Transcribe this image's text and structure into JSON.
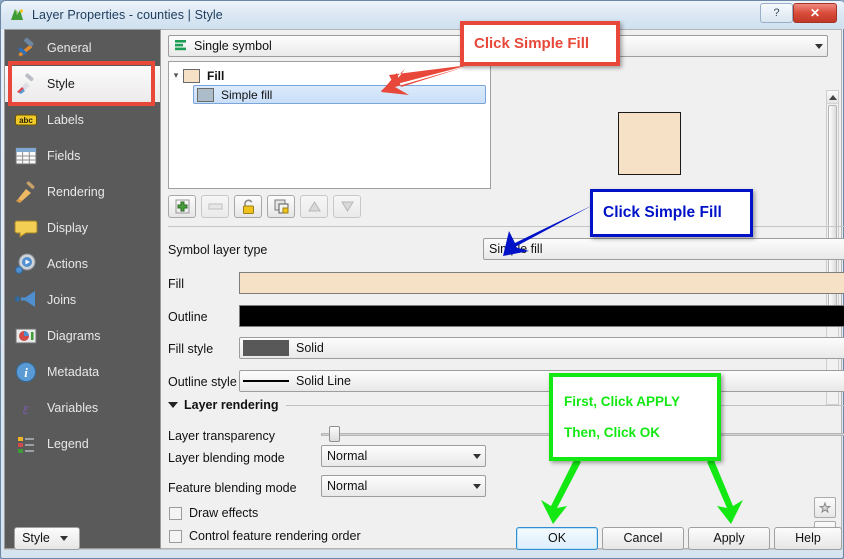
{
  "window": {
    "title": "Layer Properties - counties | Style",
    "app_icon": "qgis-icon",
    "help_button": "?",
    "close_button": "✕"
  },
  "sidebar": {
    "items": [
      {
        "label": "General",
        "icon": "hammer-wrench-icon",
        "selected": false
      },
      {
        "label": "Style",
        "icon": "paintbrush-icon",
        "selected": true
      },
      {
        "label": "Labels",
        "icon": "abc-label-icon",
        "selected": false
      },
      {
        "label": "Fields",
        "icon": "table-grid-icon",
        "selected": false
      },
      {
        "label": "Rendering",
        "icon": "broom-icon",
        "selected": false
      },
      {
        "label": "Display",
        "icon": "speech-bubble-icon",
        "selected": false
      },
      {
        "label": "Actions",
        "icon": "gear-play-icon",
        "selected": false
      },
      {
        "label": "Joins",
        "icon": "join-arrow-icon",
        "selected": false
      },
      {
        "label": "Diagrams",
        "icon": "pie-chart-icon",
        "selected": false
      },
      {
        "label": "Metadata",
        "icon": "info-circle-icon",
        "selected": false
      },
      {
        "label": "Variables",
        "icon": "epsilon-icon",
        "selected": false
      },
      {
        "label": "Legend",
        "icon": "legend-list-icon",
        "selected": false
      }
    ]
  },
  "renderer": {
    "selected": "Single symbol",
    "icon": "single-symbol-icon"
  },
  "symbol_tree": {
    "parent": {
      "label": "Fill",
      "swatch_color": "#f6e0c6",
      "expanded": true
    },
    "child": {
      "label": "Simple fill",
      "swatch_color": "#adbcc9",
      "selected": true
    }
  },
  "symbol_preview": {
    "fill_color": "#f6e0c6",
    "outline_color": "#1a1a1a"
  },
  "layer_toolbar": {
    "buttons": [
      {
        "name": "add-symbol-layer",
        "icon": "plus-icon",
        "enabled": true
      },
      {
        "name": "remove-symbol-layer",
        "icon": "minus-icon",
        "enabled": false
      },
      {
        "name": "lock-colors",
        "icon": "lock-icon",
        "enabled": true
      },
      {
        "name": "duplicate-layer",
        "icon": "duplicate-icon",
        "enabled": true
      },
      {
        "name": "move-layer-up",
        "icon": "arrow-up-icon",
        "enabled": false
      },
      {
        "name": "move-layer-down",
        "icon": "arrow-down-icon",
        "enabled": false
      }
    ]
  },
  "symbol_form": {
    "symbol_layer_type": {
      "label": "Symbol layer type",
      "value": "Simple fill"
    },
    "fill": {
      "label": "Fill",
      "color": "#f6e0c6"
    },
    "outline": {
      "label": "Outline",
      "color": "#000000"
    },
    "fill_style": {
      "label": "Fill style",
      "value": "Solid",
      "chip_color": "#585858"
    },
    "outline_style": {
      "label": "Outline style",
      "value": "Solid Line",
      "chip_color": "#000000"
    },
    "data_defined_icon": "data-defined-override-icon"
  },
  "layer_rendering": {
    "title": "Layer rendering",
    "transparency": {
      "label": "Layer transparency",
      "value": "0"
    },
    "layer_blending": {
      "label": "Layer blending mode",
      "value": "Normal"
    },
    "feature_blending": {
      "label": "Feature blending mode",
      "value": "Normal"
    },
    "draw_effects": {
      "label": "Draw effects",
      "checked": false
    },
    "control_order": {
      "label": "Control feature rendering order",
      "checked": false
    },
    "effects_button": "effects-star-icon",
    "sort_button": "sort-az-icon"
  },
  "footer": {
    "style_button": "Style",
    "ok_button": "OK",
    "cancel_button": "Cancel",
    "apply_button": "Apply",
    "help_button": "Help"
  },
  "annotations": {
    "red_callout": {
      "text": "Click Simple Fill",
      "color": "#e8483a"
    },
    "blue_callout": {
      "text": "Click Simple Fill",
      "color": "#0012c8"
    },
    "green_callout": {
      "line1": "First, Click APPLY",
      "line2": "Then, Click OK",
      "color": "#13e813"
    }
  }
}
